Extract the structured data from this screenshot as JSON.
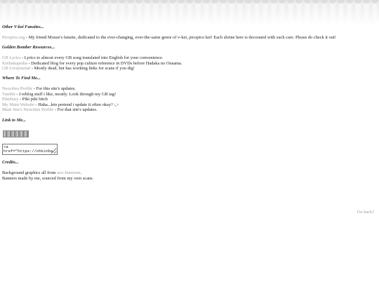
{
  "sections": {
    "fansites": {
      "heading": "Other V-kei Fansites...",
      "items": [
        {
          "link": "Picopico.org",
          "text": " - My friend Mouse's fansite, dedicated to the ever-changing, ever-the-same genre of v-kei, picopico kei! Each shrine here is decorated with such care. Please do check it out!"
        }
      ]
    },
    "resources": {
      "heading": "Golden Bomber Resources...",
      "items": [
        {
          "link": "GB Lyrics",
          "text": " - Lyrics to almost every GB song translated into English for your convenience."
        },
        {
          "link": "Kinbakupedia",
          "text": " - Dedicated blog for every pop culture reference in DVDs before Hadaka no Ousama."
        },
        {
          "link": "GB Livejournal",
          "text": " - Mostly dead, but has working links for scans if you dig!"
        }
      ]
    },
    "find_me": {
      "heading": "Where To Find Me...",
      "items": [
        {
          "link": "Neocities Profile",
          "text": " - For this site's updates."
        },
        {
          "link": "Tumblr",
          "text": " - I reblog stuff i like, mostly. Look through my GB tag!"
        },
        {
          "link": "Pikidiary",
          "text": " - Piki piki bitch"
        },
        {
          "link": "My Main Website",
          "text": " - Haha...lets pretend i update it often okay? :,>"
        },
        {
          "link": "Main Site's Neocities Profile",
          "text": " - For that site's updates."
        }
      ]
    },
    "link_to_me": {
      "heading": "Link to Me...",
      "code_value": "<a\nhref=\"https://ohkinba"
    },
    "credits": {
      "heading": "Credits...",
      "line1_pre": "Background graphics all from ",
      "line1_link": "neo-himeism",
      "line1_post": ".",
      "line2": "Banners made by me, sourced from my own scans."
    }
  },
  "go_back": "Go back?"
}
